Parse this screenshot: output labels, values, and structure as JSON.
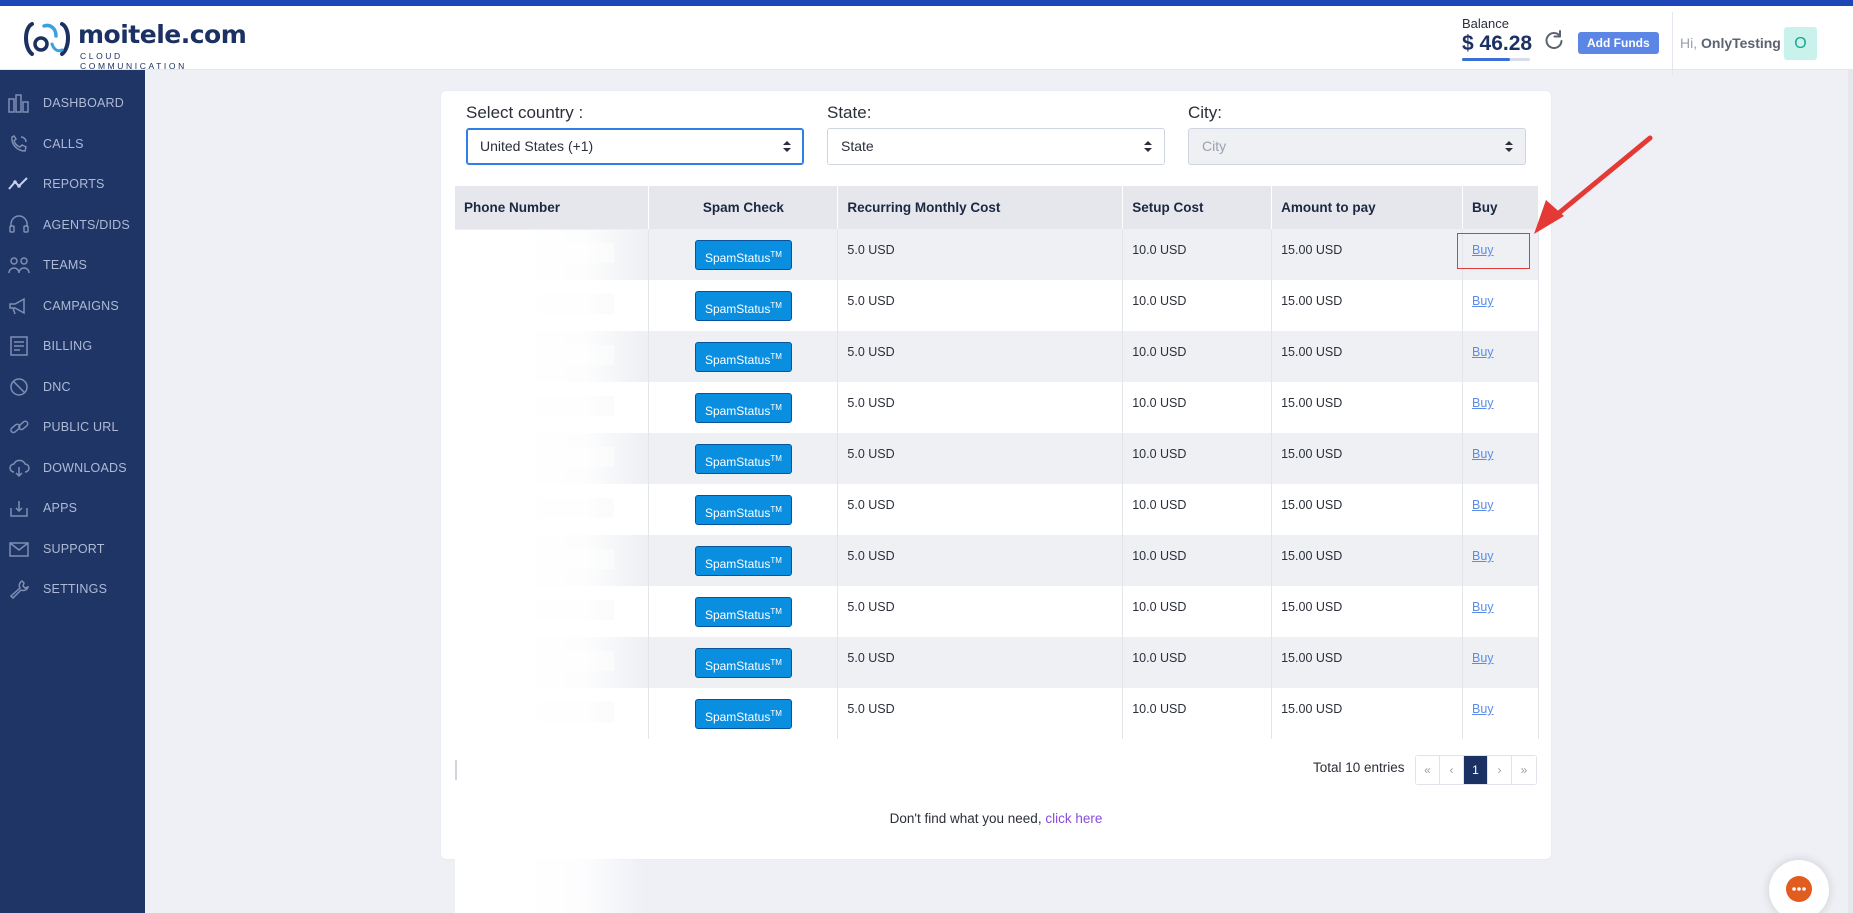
{
  "app": {
    "brand": "moitele.com",
    "tagline": "CLOUD COMMUNICATION"
  },
  "header": {
    "balance_label": "Balance",
    "balance_amount": "$ 46.28",
    "add_funds_label": "Add Funds",
    "greeting_prefix": "Hi, ",
    "user_name": "OnlyTesting",
    "avatar_initial": "O"
  },
  "sidebar": {
    "items": [
      {
        "label": "DASHBOARD",
        "icon": "dashboard-icon"
      },
      {
        "label": "CALLS",
        "icon": "calls-icon"
      },
      {
        "label": "REPORTS",
        "icon": "reports-icon"
      },
      {
        "label": "AGENTS/DIDS",
        "icon": "headset-icon"
      },
      {
        "label": "TEAMS",
        "icon": "teams-icon"
      },
      {
        "label": "CAMPAIGNS",
        "icon": "megaphone-icon"
      },
      {
        "label": "BILLING",
        "icon": "billing-icon"
      },
      {
        "label": "DNC",
        "icon": "block-icon"
      },
      {
        "label": "PUBLIC URL",
        "icon": "link-icon"
      },
      {
        "label": "DOWNLOADS",
        "icon": "cloud-download-icon"
      },
      {
        "label": "APPS",
        "icon": "apps-icon"
      },
      {
        "label": "SUPPORT",
        "icon": "mail-icon"
      },
      {
        "label": "SETTINGS",
        "icon": "wrench-icon"
      }
    ]
  },
  "filters": {
    "country_label": "Select country :",
    "country_value": "United States (+1)",
    "state_label": "State:",
    "state_value": "State",
    "city_label": "City:",
    "city_value": "City"
  },
  "table": {
    "headers": [
      "Phone Number",
      "Spam Check",
      "Recurring Monthly Cost",
      "Setup Cost",
      "Amount to pay",
      "Buy"
    ],
    "spam_button_label": "SpamStatus",
    "spam_button_sup": "TM",
    "rows": [
      {
        "monthly": "5.0 USD",
        "setup": "10.0 USD",
        "amount": "15.00 USD",
        "buy": "Buy"
      },
      {
        "monthly": "5.0 USD",
        "setup": "10.0 USD",
        "amount": "15.00 USD",
        "buy": "Buy"
      },
      {
        "monthly": "5.0 USD",
        "setup": "10.0 USD",
        "amount": "15.00 USD",
        "buy": "Buy"
      },
      {
        "monthly": "5.0 USD",
        "setup": "10.0 USD",
        "amount": "15.00 USD",
        "buy": "Buy"
      },
      {
        "monthly": "5.0 USD",
        "setup": "10.0 USD",
        "amount": "15.00 USD",
        "buy": "Buy"
      },
      {
        "monthly": "5.0 USD",
        "setup": "10.0 USD",
        "amount": "15.00 USD",
        "buy": "Buy"
      },
      {
        "monthly": "5.0 USD",
        "setup": "10.0 USD",
        "amount": "15.00 USD",
        "buy": "Buy"
      },
      {
        "monthly": "5.0 USD",
        "setup": "10.0 USD",
        "amount": "15.00 USD",
        "buy": "Buy"
      },
      {
        "monthly": "5.0 USD",
        "setup": "10.0 USD",
        "amount": "15.00 USD",
        "buy": "Buy"
      },
      {
        "monthly": "5.0 USD",
        "setup": "10.0 USD",
        "amount": "15.00 USD",
        "buy": "Buy"
      }
    ]
  },
  "pagination": {
    "total_text": "Total 10 entries",
    "first": "«",
    "prev": "‹",
    "current": "1",
    "next": "›",
    "last": "»"
  },
  "footer": {
    "not_found_text": "Don't find what you need, ",
    "click_here": "click here"
  },
  "colors": {
    "sidebar_bg": "#1f3566",
    "accent": "#1d47b8",
    "spam_button": "#0a8fe0",
    "highlight": "#e03b3b"
  }
}
